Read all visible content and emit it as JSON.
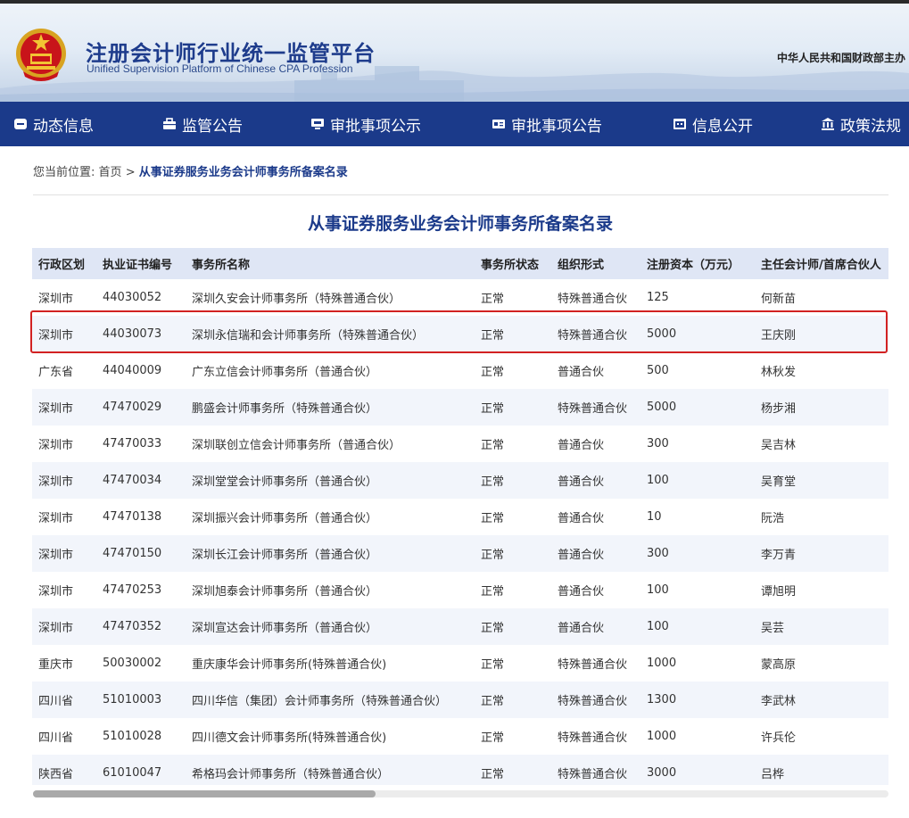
{
  "header": {
    "title": "注册会计师行业统一监管平台",
    "subtitle": "Unified Supervision Platform of Chinese CPA Profession",
    "host": "中华人民共和国财政部主办"
  },
  "nav": {
    "items": [
      {
        "label": "动态信息",
        "icon": "news-icon"
      },
      {
        "label": "监管公告",
        "icon": "briefcase-icon"
      },
      {
        "label": "审批事项公示",
        "icon": "monitor-icon"
      },
      {
        "label": "审批事项公告",
        "icon": "id-card-icon"
      },
      {
        "label": "信息公开",
        "icon": "calendar-icon"
      },
      {
        "label": "政策法规",
        "icon": "institution-icon"
      }
    ]
  },
  "breadcrumb": {
    "prefix": "您当前位置:",
    "home": "首页",
    "separator": ">",
    "current": "从事证券服务业务会计师事务所备案名录"
  },
  "page": {
    "title": "从事证券服务业务会计师事务所备案名录"
  },
  "table": {
    "headers": [
      "行政区划",
      "执业证书编号",
      "事务所名称",
      "事务所状态",
      "组织形式",
      "注册资本（万元）",
      "主任会计师/首席合伙人"
    ],
    "rows": [
      [
        "深圳市",
        "44030052",
        "深圳久安会计师事务所（特殊普通合伙）",
        "正常",
        "特殊普通合伙",
        "125",
        "何新苗"
      ],
      [
        "深圳市",
        "44030073",
        "深圳永信瑞和会计师事务所（特殊普通合伙）",
        "正常",
        "特殊普通合伙",
        "5000",
        "王庆刚"
      ],
      [
        "广东省",
        "44040009",
        "广东立信会计师事务所（普通合伙）",
        "正常",
        "普通合伙",
        "500",
        "林秋发"
      ],
      [
        "深圳市",
        "47470029",
        "鹏盛会计师事务所（特殊普通合伙）",
        "正常",
        "特殊普通合伙",
        "5000",
        "杨步湘"
      ],
      [
        "深圳市",
        "47470033",
        "深圳联创立信会计师事务所（普通合伙）",
        "正常",
        "普通合伙",
        "300",
        "吴吉林"
      ],
      [
        "深圳市",
        "47470034",
        "深圳堂堂会计师事务所（普通合伙）",
        "正常",
        "普通合伙",
        "100",
        "吴育堂"
      ],
      [
        "深圳市",
        "47470138",
        "深圳振兴会计师事务所（普通合伙）",
        "正常",
        "普通合伙",
        "10",
        "阮浩"
      ],
      [
        "深圳市",
        "47470150",
        "深圳长江会计师事务所（普通合伙）",
        "正常",
        "普通合伙",
        "300",
        "李万青"
      ],
      [
        "深圳市",
        "47470253",
        "深圳旭泰会计师事务所（普通合伙）",
        "正常",
        "普通合伙",
        "100",
        "谭旭明"
      ],
      [
        "深圳市",
        "47470352",
        "深圳宣达会计师事务所（普通合伙）",
        "正常",
        "普通合伙",
        "100",
        "吴芸"
      ],
      [
        "重庆市",
        "50030002",
        "重庆康华会计师事务所(特殊普通合伙)",
        "正常",
        "特殊普通合伙",
        "1000",
        "蒙高原"
      ],
      [
        "四川省",
        "51010003",
        "四川华信（集团）会计师事务所（特殊普通合伙）",
        "正常",
        "特殊普通合伙",
        "1300",
        "李武林"
      ],
      [
        "四川省",
        "51010028",
        "四川德文会计师事务所(特殊普通合伙)",
        "正常",
        "特殊普通合伙",
        "1000",
        "许兵伦"
      ],
      [
        "陕西省",
        "61010047",
        "希格玛会计师事务所（特殊普通合伙）",
        "正常",
        "特殊普通合伙",
        "3000",
        "吕桦"
      ]
    ],
    "highlighted_row": 1,
    "horizontal_scroll_fraction": 0.4
  },
  "colors": {
    "nav_bg": "#1b3a8a",
    "title_blue": "#1b3a8a",
    "header_row_bg": "#dfe6f5",
    "stripe_bg": "#f2f5fb",
    "highlight_border": "#d22222"
  }
}
